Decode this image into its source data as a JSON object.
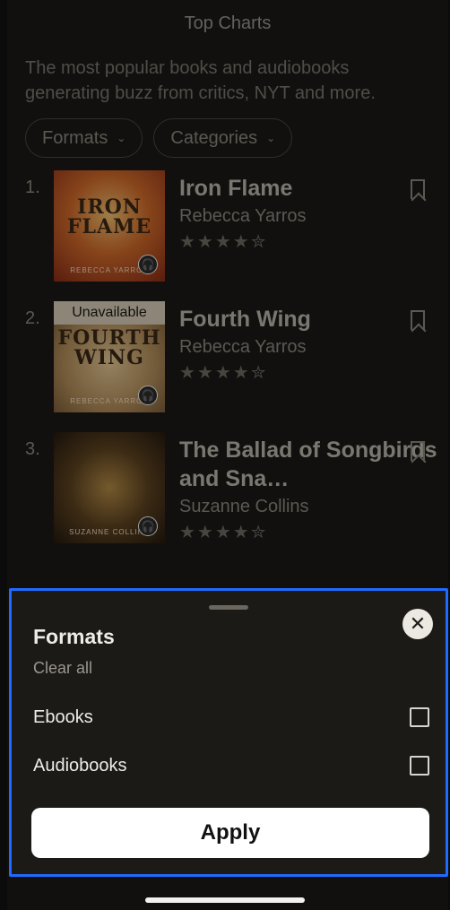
{
  "header": {
    "title": "Top Charts"
  },
  "subtitle": "The most popular books and audiobooks generating buzz from critics, NYT and more.",
  "filters": [
    {
      "label": "Formats"
    },
    {
      "label": "Categories"
    }
  ],
  "books": [
    {
      "rank": "1.",
      "title": "Iron Flame",
      "author": "Rebecca Yarros",
      "stars": "★★★★✮",
      "cover_title": "IRON FLAME",
      "cover_author": "REBECCA YARROS",
      "badge": "",
      "cover_color": "#c2673a"
    },
    {
      "rank": "2.",
      "title": "Fourth Wing",
      "author": "Rebecca Yarros",
      "stars": "★★★★✮",
      "cover_title": "FOURTH WING",
      "cover_author": "REBECCA YARROS",
      "badge": "Unavailable",
      "cover_color": "#b99c6e"
    },
    {
      "rank": "3.",
      "title": "The Ballad of Songbirds and Sna…",
      "author": "Suzanne Collins",
      "stars": "★★★★✮",
      "cover_title": "",
      "cover_author": "SUZANNE COLLINS",
      "badge": "",
      "cover_color": "#4a3a22"
    }
  ],
  "sheet": {
    "title": "Formats",
    "clear_all": "Clear all",
    "options": [
      {
        "label": "Ebooks",
        "checked": false
      },
      {
        "label": "Audiobooks",
        "checked": false
      }
    ],
    "apply_label": "Apply"
  },
  "colors": {
    "selection_outline": "#1f6bff",
    "background": "#1c1a17"
  }
}
